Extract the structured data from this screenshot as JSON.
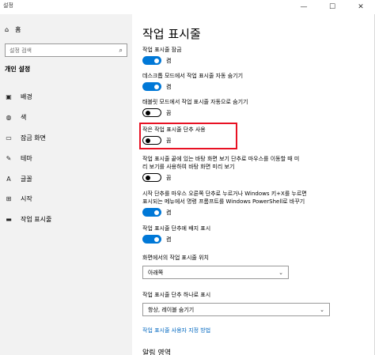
{
  "window": {
    "title": "설정",
    "minimize": "—",
    "maximize": "☐",
    "close": "✕"
  },
  "sidebar": {
    "home_label": "홈",
    "search_placeholder": "설정 검색",
    "section_title": "개인 설정",
    "items": [
      {
        "label": "배경",
        "icon": "image-icon"
      },
      {
        "label": "색",
        "icon": "palette-icon"
      },
      {
        "label": "잠금 화면",
        "icon": "lock-screen-icon"
      },
      {
        "label": "테마",
        "icon": "theme-icon"
      },
      {
        "label": "글꼴",
        "icon": "font-icon"
      },
      {
        "label": "시작",
        "icon": "start-icon"
      },
      {
        "label": "작업 표시줄",
        "icon": "taskbar-icon"
      }
    ]
  },
  "main": {
    "title": "작업 표시줄",
    "settings": [
      {
        "label": "작업 표시줄 잠금",
        "state": "켬",
        "on": true
      },
      {
        "label": "데스크톱 모드에서 작업 표시줄 자동 숨기기",
        "state": "켬",
        "on": true
      },
      {
        "label": "태블릿 모드에서 작업 표시줄 자동으로 숨기기",
        "state": "끔",
        "on": false
      },
      {
        "label": "작은 작업 표시줄 단추 사용",
        "state": "끔",
        "on": false
      },
      {
        "label_line1": "작업 표시줄 끝에 있는 바탕 화면 보기 단추로 마우스를 이동할 때 미",
        "label_line2": "리 보기를 사용하여 바탕 화면 미리 보기",
        "state": "끔",
        "on": false
      },
      {
        "label_line1": "시작 단추를 마우스 오른쪽 단추로 누르거나 Windows 키+X를 누르면",
        "label_line2": "표시되는 메뉴에서 명령 프롬프트를 Windows PowerShell로 바꾸기",
        "state": "켬",
        "on": true
      },
      {
        "label": "작업 표시줄 단추에 배지 표시",
        "state": "켬",
        "on": true
      }
    ],
    "position_label": "화면에서의 작업 표시줄 위치",
    "position_value": "아래쪽",
    "combine_label": "작업 표시줄 단추 하나로 표시",
    "combine_value": "항상, 레이블 숨기기",
    "customize_link": "작업 표시줄 사용자 지정 방법",
    "next_heading": "알림 영역"
  }
}
